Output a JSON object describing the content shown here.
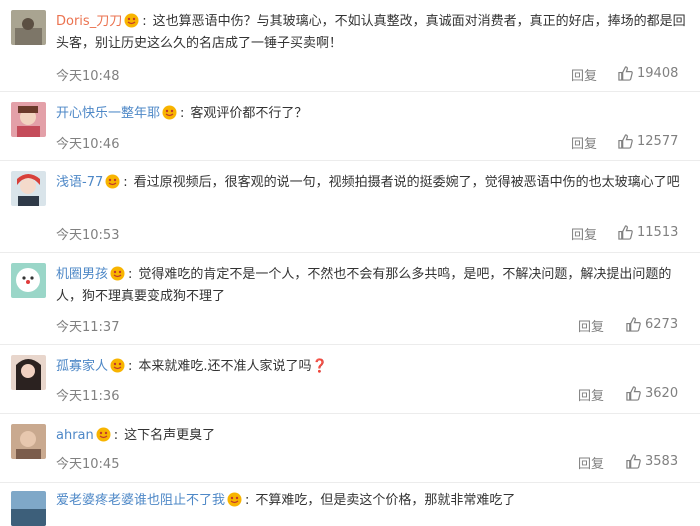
{
  "comments": [
    {
      "username": "Doris_刀刀",
      "text": "这也算恶语中伤？与其玻璃心，不如认真整改，真诚面对消费者，真正的好店，捧场的都是回头客，别让历史这么久的名店成了一锤子买卖啊！",
      "time": "今天10:48",
      "reply": "回复",
      "likes": "19408"
    },
    {
      "username": "开心快乐一整年耶",
      "text": "客观评价都不行了？",
      "time": "今天10:46",
      "reply": "回复",
      "likes": "12577"
    },
    {
      "username": "浅语-77",
      "text": "看过原视频后，很客观的说一句，视频拍摄者说的挺委婉了，觉得被恶语中伤的也太玻璃心了吧",
      "time": "今天10:53",
      "reply": "回复",
      "likes": "11513"
    },
    {
      "username": "机圈男孩",
      "text": "觉得难吃的肯定不是一个人，不然也不会有那么多共鸣，是吧，不解决问题，解决提出问题的人，狗不理真要变成狗不理了",
      "time": "今天11:37",
      "reply": "回复",
      "likes": "6273"
    },
    {
      "username": "孤寡家人",
      "text": "本来就难吃.还不准人家说了吗",
      "emoji": "❓",
      "time": "今天11:36",
      "reply": "回复",
      "likes": "3620"
    },
    {
      "username": "ahran",
      "text": "这下名声更臭了",
      "time": "今天10:45",
      "reply": "回复",
      "likes": "3583"
    },
    {
      "username": "爱老婆疼老婆谁也阻止不了我",
      "text": "不算难吃，但是卖这个价格，那就非常难吃了"
    }
  ],
  "colors": {
    "username": "#eb7350",
    "username_alt": "#4e88c7",
    "meta": "#808080",
    "divider": "#ececec"
  }
}
